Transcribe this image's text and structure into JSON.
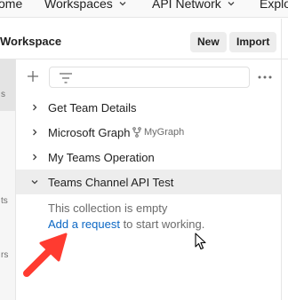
{
  "topnav": {
    "home_fragment": "ome",
    "workspaces": "Workspaces",
    "api_network": "API Network",
    "explore_fragment": "Explo"
  },
  "workspace": {
    "title_fragment": "Workspace",
    "new_label": "New",
    "import_label": "Import"
  },
  "rail": {
    "frag1": "s",
    "frag2": "ts",
    "frag3": "rs"
  },
  "tree": {
    "items": [
      {
        "label": "Get Team Details",
        "expanded": false
      },
      {
        "label": "Microsoft Graph",
        "fork": "MyGraph",
        "expanded": false
      },
      {
        "label": "My Teams Operation",
        "expanded": false
      },
      {
        "label": "Teams Channel API Test",
        "expanded": true
      }
    ],
    "empty_message": "This collection is empty",
    "add_request_link": "Add a request",
    "add_request_suffix": " to start working."
  },
  "colors": {
    "link": "#0b67c4",
    "arrow": "#ff3b30",
    "selected_row": "#ededed"
  }
}
